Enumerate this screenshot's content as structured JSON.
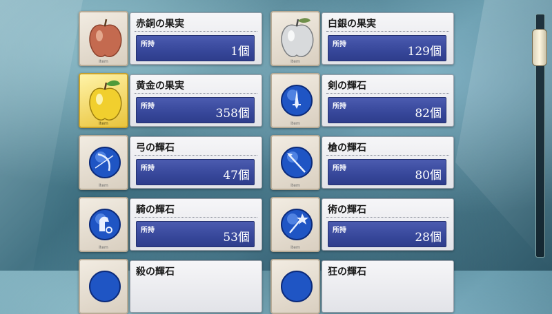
{
  "label_owned": "所持",
  "item_tag": "Item",
  "items": [
    {
      "name": "赤銅の果実",
      "count": "1個",
      "icon": "bronze-apple-icon"
    },
    {
      "name": "白銀の果実",
      "count": "129個",
      "icon": "silver-apple-icon"
    },
    {
      "name": "黄金の果実",
      "count": "358個",
      "icon": "gold-apple-icon"
    },
    {
      "name": "剣の輝石",
      "count": "82個",
      "icon": "saber-gem-icon"
    },
    {
      "name": "弓の輝石",
      "count": "47個",
      "icon": "archer-gem-icon"
    },
    {
      "name": "槍の輝石",
      "count": "80個",
      "icon": "lancer-gem-icon"
    },
    {
      "name": "騎の輝石",
      "count": "53個",
      "icon": "rider-gem-icon"
    },
    {
      "name": "術の輝石",
      "count": "28個",
      "icon": "caster-gem-icon"
    },
    {
      "name": "殺の輝石",
      "count": "",
      "icon": "assassin-gem-icon"
    },
    {
      "name": "狂の輝石",
      "count": "",
      "icon": "berserker-gem-icon"
    }
  ],
  "colors": {
    "count_box": "#37479a",
    "gold_frame": "#e9c43c"
  }
}
